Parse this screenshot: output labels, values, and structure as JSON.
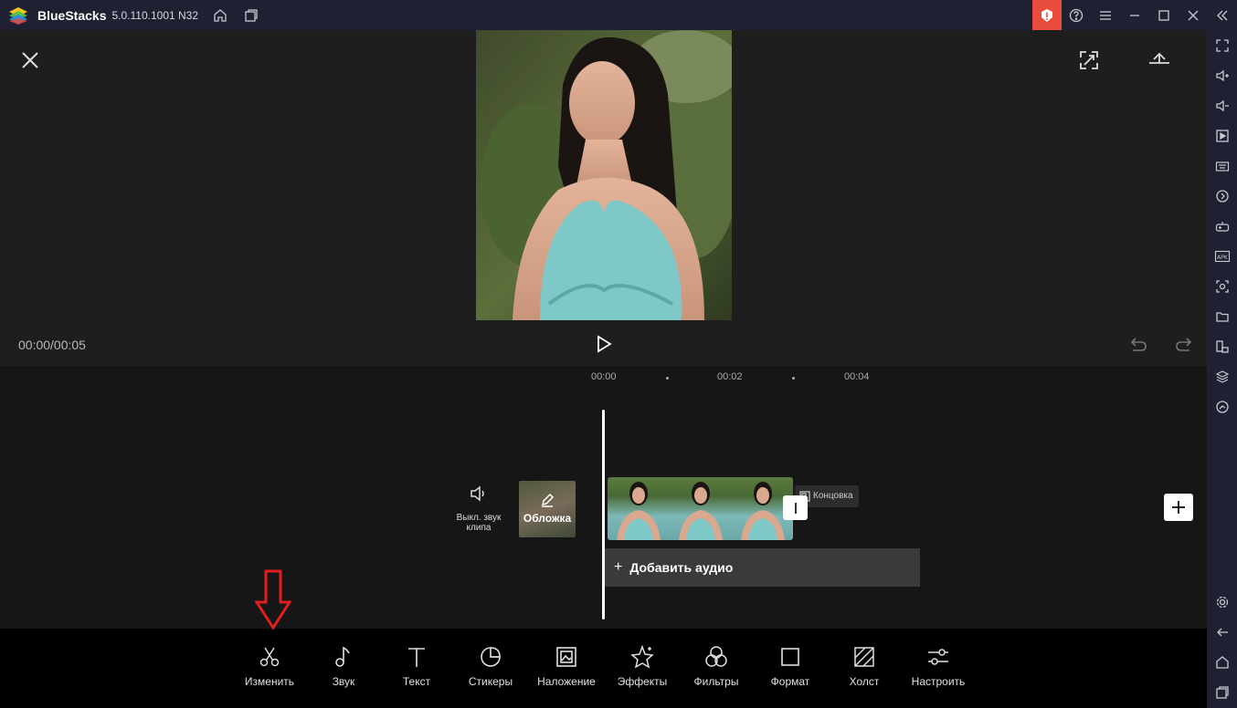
{
  "window": {
    "app_name": "BlueStacks",
    "version": "5.0.110.1001 N32"
  },
  "colors": {
    "alert": "#e74c3c",
    "arrow": "#e02020",
    "chrome": "#1f2133"
  },
  "preview": {
    "time": "00:00/00:05"
  },
  "timeline": {
    "ruler": [
      "00:00",
      "00:02",
      "00:04"
    ],
    "mute_label": "Выкл. звук клипа",
    "cover_label": "Обложка",
    "end_label": "Концовка",
    "add_audio_label": "Добавить аудио"
  },
  "toolbar": {
    "items": [
      {
        "label": "Изменить",
        "icon": "scissors-icon"
      },
      {
        "label": "Звук",
        "icon": "music-note-icon"
      },
      {
        "label": "Текст",
        "icon": "text-icon"
      },
      {
        "label": "Стикеры",
        "icon": "sticker-icon"
      },
      {
        "label": "Наложение",
        "icon": "overlay-icon"
      },
      {
        "label": "Эффекты",
        "icon": "effects-icon"
      },
      {
        "label": "Фильтры",
        "icon": "filters-icon"
      },
      {
        "label": "Формат",
        "icon": "format-icon"
      },
      {
        "label": "Холст",
        "icon": "canvas-icon"
      },
      {
        "label": "Настроить",
        "icon": "adjust-icon"
      }
    ]
  }
}
